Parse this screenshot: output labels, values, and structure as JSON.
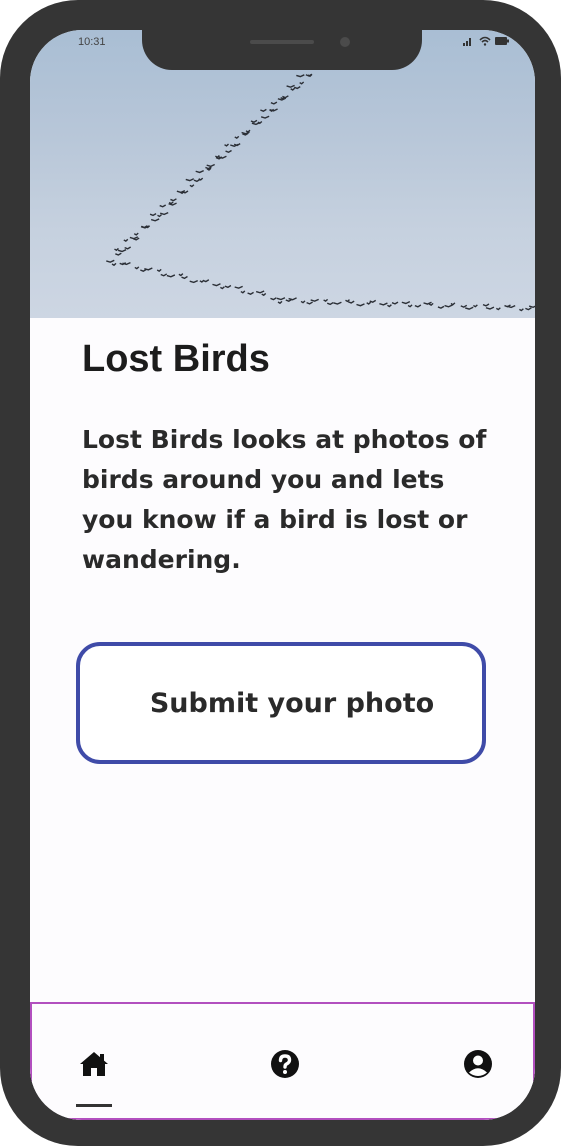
{
  "status_bar": {
    "time": "10:31"
  },
  "hero": {
    "image": "flock-of-birds-in-sky",
    "sky_color": "#b7c6d8"
  },
  "main": {
    "title": "Lost Birds",
    "description": "Lost Birds looks at photos of birds around you and lets you know if a bird is lost or wandering.",
    "submit_label": "Submit your photo"
  },
  "bottom_nav": {
    "items": [
      {
        "icon": "home-icon",
        "active": true
      },
      {
        "icon": "help-icon",
        "active": false
      },
      {
        "icon": "account-icon",
        "active": false
      }
    ]
  },
  "colors": {
    "accent": "#3f4ba8",
    "frame": "#353535",
    "nav_border": "#b24fbf",
    "text": "#1c1c1c"
  }
}
